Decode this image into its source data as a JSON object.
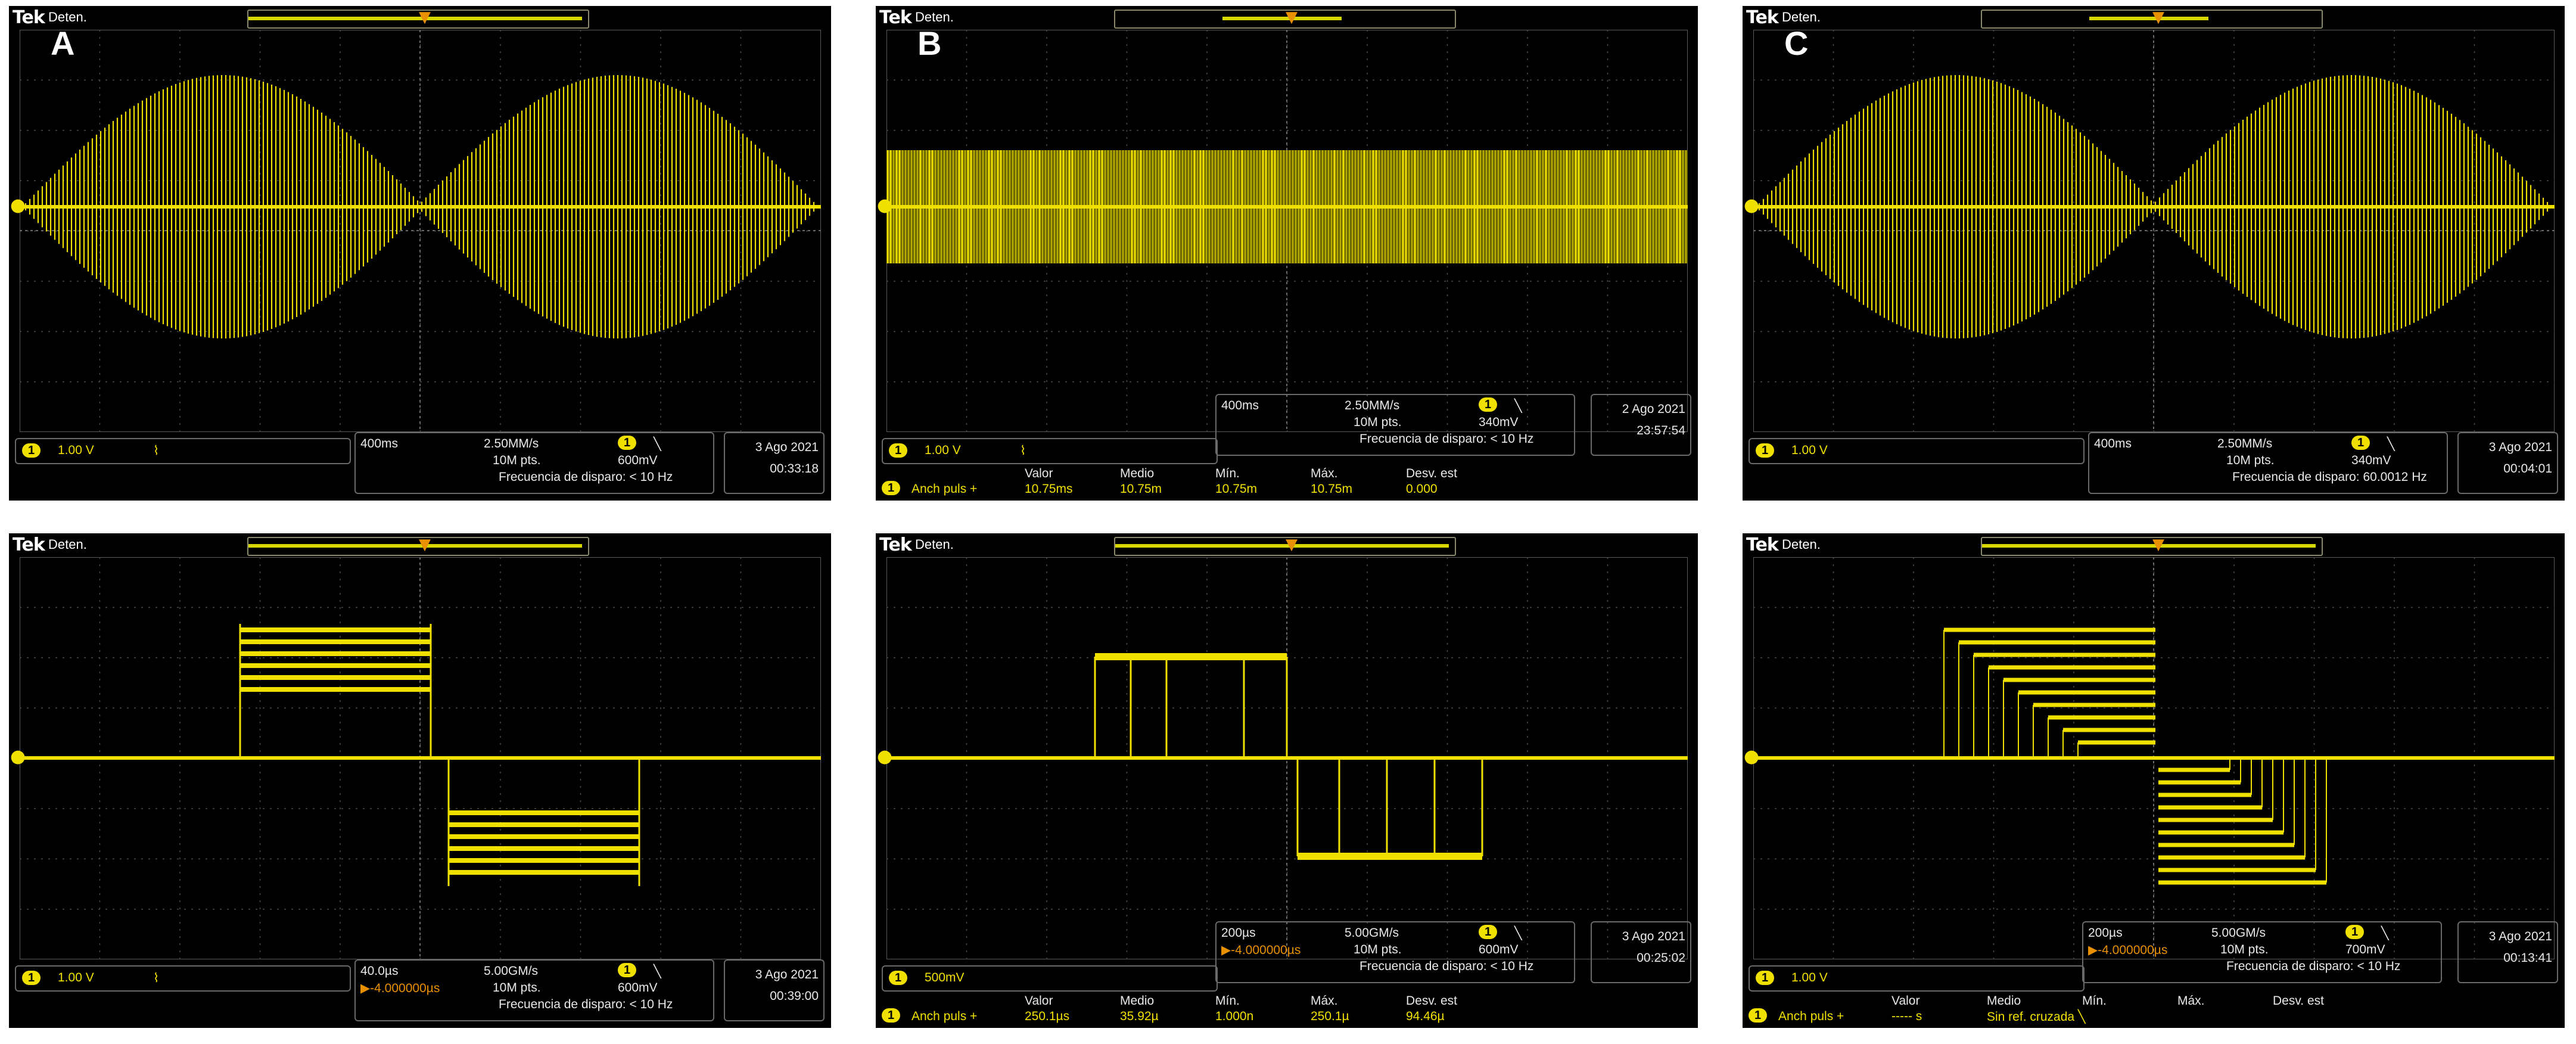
{
  "panels": [
    {
      "id": "A",
      "label": "A",
      "tek": "Tek",
      "run": "Deten.",
      "trace": "sine_am",
      "ch1": {
        "num": "1",
        "scale": "1.00 V",
        "coupling_icon": "⌇"
      },
      "horizontal": {
        "time": "400ms",
        "rate": "2.50MM/s",
        "pts": "10M pts.",
        "trig_ch": "1",
        "slope": "╲",
        "level": "600mV",
        "trig_freq": "Frecuencia de disparo: < 10 Hz"
      },
      "date": "3 Ago 2021",
      "time": "00:33:18",
      "measure": null
    },
    {
      "id": "B",
      "label": "B",
      "tek": "Tek",
      "run": "Deten.",
      "trace": "dense_band",
      "ch1": {
        "num": "1",
        "scale": "1.00 V",
        "coupling_icon": "⌇"
      },
      "horizontal": {
        "time": "400ms",
        "rate": "2.50MM/s",
        "pts": "10M pts.",
        "trig_ch": "1",
        "slope": "╲",
        "level": "340mV",
        "trig_freq": "Frecuencia de disparo: < 10 Hz"
      },
      "date": "2 Ago 2021",
      "time": "23:57:54",
      "measure": {
        "headers": [
          "Valor",
          "Medio",
          "Mín.",
          "Máx.",
          "Desv. est"
        ],
        "ch": "1",
        "name": "Anch puls +",
        "values": [
          "10.75ms",
          "10.75m",
          "10.75m",
          "10.75m",
          "0.000"
        ]
      }
    },
    {
      "id": "C",
      "label": "C",
      "tek": "Tek",
      "run": "Deten.",
      "trace": "sine_am",
      "ch1": {
        "num": "1",
        "scale": "1.00 V",
        "coupling_icon": ""
      },
      "horizontal": {
        "time": "400ms",
        "rate": "2.50MM/s",
        "pts": "10M pts.",
        "trig_ch": "1",
        "slope": "╲",
        "level": "340mV",
        "trig_freq": "Frecuencia de disparo: 60.0012 Hz"
      },
      "date": "3 Ago 2021",
      "time": "00:04:01",
      "measure": null
    },
    {
      "id": "D",
      "label": "",
      "tek": "Tek",
      "run": "Deten.",
      "trace": "multi_step",
      "ch1": {
        "num": "1",
        "scale": "1.00 V",
        "coupling_icon": "⌇"
      },
      "horizontal": {
        "time": "40.0µs",
        "delay": "▶-4.000000µs",
        "rate": "5.00GM/s",
        "pts": "10M pts.",
        "trig_ch": "1",
        "slope": "╲",
        "level": "600mV",
        "trig_freq": "Frecuencia de disparo: < 10 Hz"
      },
      "date": "3 Ago 2021",
      "time": "00:39:00",
      "measure": null
    },
    {
      "id": "E",
      "label": "",
      "tek": "Tek",
      "run": "Deten.",
      "trace": "biphasic",
      "ch1": {
        "num": "1",
        "scale": "500mV",
        "coupling_icon": ""
      },
      "horizontal": {
        "time": "200µs",
        "delay": "▶-4.000000µs",
        "rate": "5.00GM/s",
        "pts": "10M pts.",
        "trig_ch": "1",
        "slope": "╲",
        "level": "600mV",
        "trig_freq": "Frecuencia de disparo: < 10 Hz"
      },
      "date": "3 Ago 2021",
      "time": "00:25:02",
      "measure": {
        "headers": [
          "Valor",
          "Medio",
          "Mín.",
          "Máx.",
          "Desv. est"
        ],
        "ch": "1",
        "name": "Anch puls +",
        "values": [
          "250.1µs",
          "35.92µ",
          "1.000n",
          "250.1µ",
          "94.46µ"
        ]
      }
    },
    {
      "id": "F",
      "label": "",
      "tek": "Tek",
      "run": "Deten.",
      "trace": "staircase",
      "ch1": {
        "num": "1",
        "scale": "1.00 V",
        "coupling_icon": ""
      },
      "horizontal": {
        "time": "200µs",
        "delay": "▶-4.000000µs",
        "rate": "5.00GM/s",
        "pts": "10M pts.",
        "trig_ch": "1",
        "slope": "╲",
        "level": "700mV",
        "trig_freq": "Frecuencia de disparo: < 10 Hz"
      },
      "date": "3 Ago 2021",
      "time": "00:13:41",
      "measure": {
        "headers": [
          "Valor",
          "Medio",
          "Mín.",
          "Máx.",
          "Desv. est"
        ],
        "ch": "1",
        "name": "Anch puls +",
        "values": [
          "----- s",
          "Sin ref. cruzada ╲",
          "",
          "",
          ""
        ]
      }
    }
  ],
  "colors": {
    "trace": "#f0e000",
    "grid": "#4a4a4a",
    "background": "#000000",
    "label": "#ffffff"
  }
}
